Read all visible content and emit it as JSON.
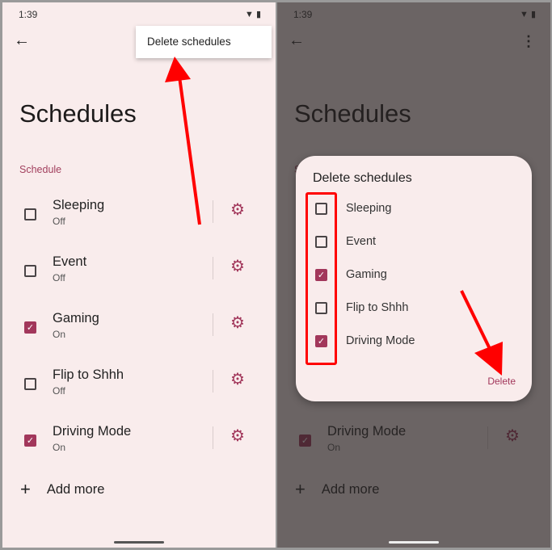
{
  "status_bar": {
    "time": "1:39",
    "icons": [
      "wifi-icon",
      "battery-icon"
    ]
  },
  "page": {
    "title": "Schedules",
    "section_label": "Schedule",
    "add_more": "Add more"
  },
  "overflow_menu": {
    "item": "Delete schedules"
  },
  "schedules": [
    {
      "name": "Sleeping",
      "state": "Off",
      "checked": false
    },
    {
      "name": "Event",
      "state": "Off",
      "checked": false
    },
    {
      "name": "Gaming",
      "state": "On",
      "checked": true
    },
    {
      "name": "Flip to Shhh",
      "state": "Off",
      "checked": false
    },
    {
      "name": "Driving Mode",
      "state": "On",
      "checked": true
    }
  ],
  "dialog": {
    "title": "Delete schedules",
    "delete_label": "Delete",
    "items": [
      {
        "label": "Sleeping",
        "checked": false
      },
      {
        "label": "Event",
        "checked": false
      },
      {
        "label": "Gaming",
        "checked": true
      },
      {
        "label": "Flip to Shhh",
        "checked": false
      },
      {
        "label": "Driving Mode",
        "checked": true
      }
    ]
  },
  "colors": {
    "accent": "#a2375b",
    "background": "#f9ecec",
    "annotation": "#ff0000"
  }
}
